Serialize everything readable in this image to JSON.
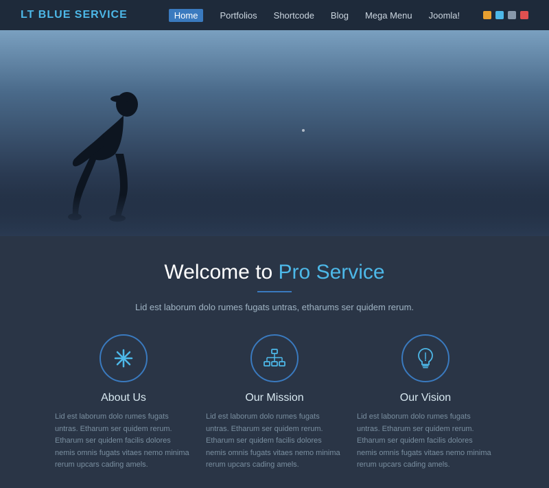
{
  "header": {
    "logo": "LT BLUE SERVICE",
    "nav": [
      {
        "label": "Home",
        "active": true
      },
      {
        "label": "Portfolios",
        "active": false
      },
      {
        "label": "Shortcode",
        "active": false
      },
      {
        "label": "Blog",
        "active": false
      },
      {
        "label": "Mega Menu",
        "active": false
      },
      {
        "label": "Joomla!",
        "active": false
      }
    ],
    "icons": [
      {
        "color": "#e8a030"
      },
      {
        "color": "#4db8e8"
      },
      {
        "color": "#8898aa"
      },
      {
        "color": "#e05050"
      }
    ]
  },
  "hero": {},
  "content": {
    "welcome_prefix": "Welcome to ",
    "welcome_highlight": "Pro Service",
    "subtitle": "Lid est laborum dolo rumes fugats untras, etharums ser quidem rerum.",
    "features": [
      {
        "icon": "✳",
        "title": "About Us",
        "text": "Lid est laborum dolo rumes fugats untras. Etharum ser quidem rerum. Etharum ser quidem facilis dolores nemis omnis fugats vitaes nemo minima rerum upcars cading amels."
      },
      {
        "icon": "⬡",
        "title": "Our Mission",
        "text": "Lid est laborum dolo rumes fugats untras. Etharum ser quidem rerum. Etharum ser quidem facilis dolores nemis omnis fugats vitaes nemo minima rerum upcars cading amels."
      },
      {
        "icon": "💡",
        "title": "Our Vision",
        "text": "Lid est laborum dolo rumes fugats untras. Etharum ser quidem rerum. Etharum ser quidem facilis dolores nemis omnis fugats vitaes nemo minima rerum upcars cading amels."
      }
    ]
  }
}
